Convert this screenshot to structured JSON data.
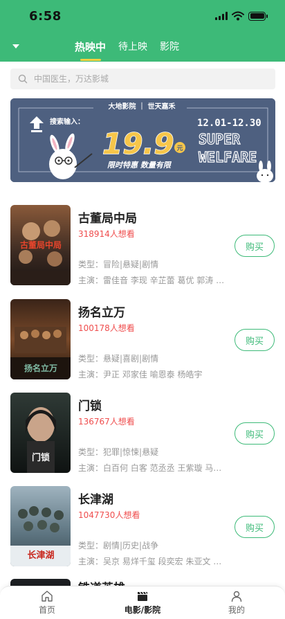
{
  "status_bar": {
    "time": "6:58"
  },
  "top_tabs": [
    {
      "label": "热映中",
      "active": true
    },
    {
      "label": "待上映",
      "active": false
    },
    {
      "label": "影院",
      "active": false
    }
  ],
  "search": {
    "placeholder": "中国医生，万达影城"
  },
  "banner": {
    "brand": "大地影院 ｜ 世天嘉禾",
    "search_hint": "搜索输入：",
    "price": "19.9",
    "price_unit": "元",
    "tagline": "限时特惠  数量有限",
    "dates": "12.01-12.30",
    "super_text": "SUPER",
    "welfare_text": "WELFARE"
  },
  "movies": [
    {
      "title": "古董局中局",
      "want": "318914人想看",
      "genre": "类型：冒险|悬疑|剧情",
      "cast": "主演：雷佳音 李现 辛芷蕾 葛优 郭涛 …",
      "buy_label": "购买",
      "poster_text": "古董局中局"
    },
    {
      "title": "扬名立万",
      "want": "100178人想看",
      "genre": "类型：悬疑|喜剧|剧情",
      "cast": "主演：尹正 邓家佳 喻恩泰 杨皓宇",
      "buy_label": "购买",
      "poster_text": "扬名立万"
    },
    {
      "title": "门锁",
      "want": "136767人想看",
      "genre": "类型：犯罪|惊悚|悬疑",
      "cast": "主演：白百何 白客 范丞丞 王紫璇 马…",
      "buy_label": "购买",
      "poster_text": "门锁"
    },
    {
      "title": "长津湖",
      "want": "1047730人想看",
      "genre": "类型：剧情|历史|战争",
      "cast": "主演：吴京 易烊千玺 段奕宏 朱亚文 …",
      "buy_label": "购买",
      "poster_text": "长津湖"
    }
  ],
  "partial_movie": {
    "title": "铁道英雄"
  },
  "bottom_nav": [
    {
      "label": "首页",
      "icon": "home-icon",
      "active": false
    },
    {
      "label": "电影/影院",
      "icon": "clapperboard-icon",
      "active": true
    },
    {
      "label": "我的",
      "icon": "person-icon",
      "active": false
    }
  ],
  "colors": {
    "brand_green": "#3dba78",
    "highlight_red": "#ef4d4d",
    "tab_underline": "#f4d03f"
  }
}
